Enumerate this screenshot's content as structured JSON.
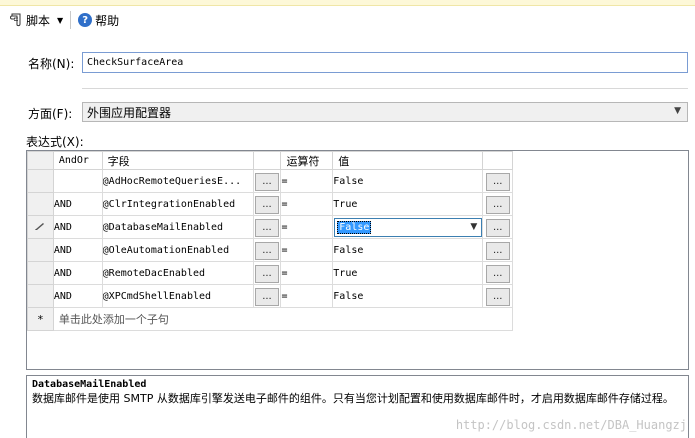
{
  "toolbar": {
    "script_label": "脚本",
    "help_label": "帮助"
  },
  "form": {
    "name_label": "名称(N):",
    "name_value": "CheckSurfaceArea",
    "facet_label": "方面(F):",
    "facet_value": "外围应用配置器",
    "expression_label": "表达式(X):"
  },
  "grid": {
    "headers": {
      "andor": "AndOr",
      "field": "字段",
      "operator": "运算符",
      "value": "值"
    },
    "ellipsis": "...",
    "rows": [
      {
        "andor": "",
        "field": "@AdHocRemoteQueriesE...",
        "operator": "=",
        "value": "False"
      },
      {
        "andor": "AND",
        "field": "@ClrIntegrationEnabled",
        "operator": "=",
        "value": "True"
      },
      {
        "andor": "AND",
        "field": "@DatabaseMailEnabled",
        "operator": "=",
        "value": "False"
      },
      {
        "andor": "AND",
        "field": "@OleAutomationEnabled",
        "operator": "=",
        "value": "False"
      },
      {
        "andor": "AND",
        "field": "@RemoteDacEnabled",
        "operator": "=",
        "value": "True"
      },
      {
        "andor": "AND",
        "field": "@XPCmdShellEnabled",
        "operator": "=",
        "value": "False"
      }
    ],
    "new_row_marker": "*",
    "new_row_text": "单击此处添加一个子句"
  },
  "description": {
    "title": "DatabaseMailEnabled",
    "body": "数据库邮件是使用 SMTP 从数据库引擎发送电子邮件的组件。只有当您计划配置和使用数据库邮件时，才启用数据库邮件存储过程。"
  },
  "watermark": "http://blog.csdn.net/DBA_Huangzj"
}
